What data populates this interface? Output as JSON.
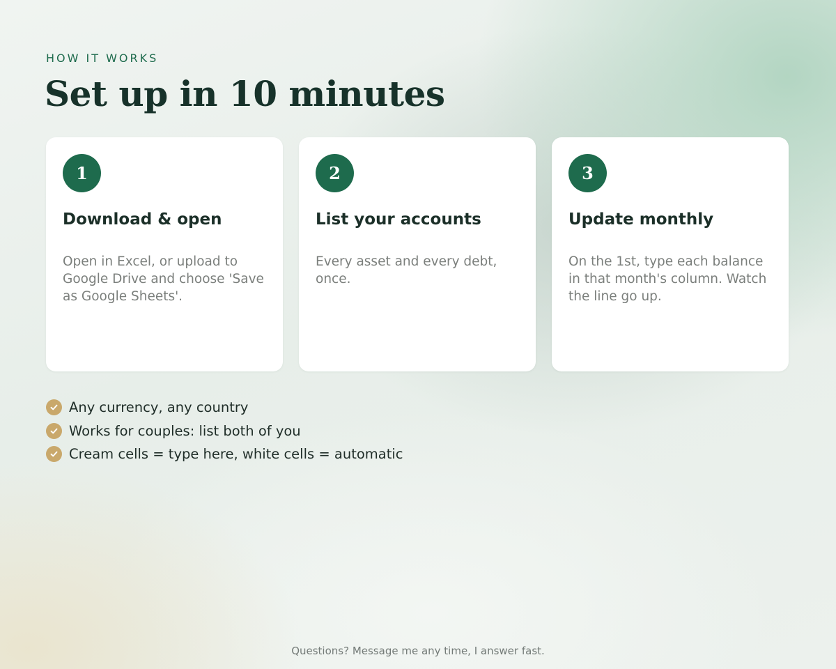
{
  "header": {
    "eyebrow": "HOW IT WORKS",
    "title": "Set up in 10 minutes"
  },
  "steps": [
    {
      "number": "1",
      "title": "Download & open",
      "text": "Open in Excel, or upload to Google Drive and choose 'Save as Google Sheets'."
    },
    {
      "number": "2",
      "title": "List your accounts",
      "text": "Every asset and every debt, once."
    },
    {
      "number": "3",
      "title": "Update monthly",
      "text": "On the 1st, type each balance in that month's column. Watch the line go up."
    }
  ],
  "features": [
    "Any currency, any country",
    "Works for couples: list both of you",
    "Cream cells = type here, white cells = automatic"
  ],
  "footer": {
    "text": "Questions? Message me any time, I answer fast."
  },
  "colors": {
    "accent_green": "#1e6b4d",
    "check_gold": "#c9a86b",
    "heading": "#17322a"
  },
  "icons": {
    "feature_bullet": "checkmark-icon"
  }
}
